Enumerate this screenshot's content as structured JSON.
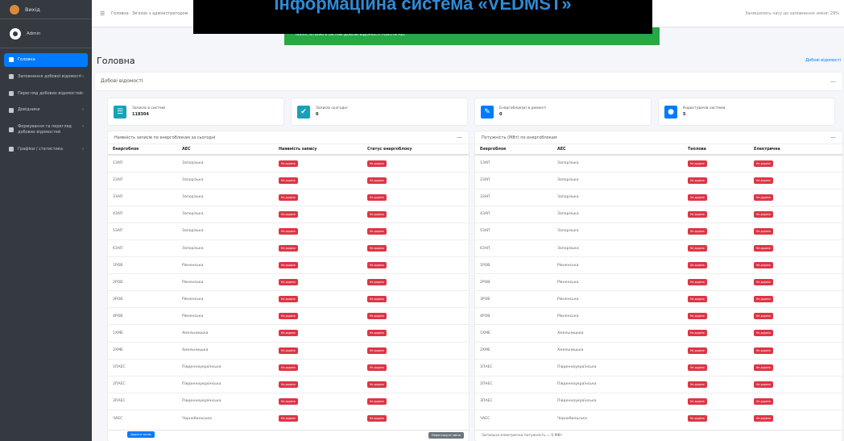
{
  "app": {
    "name": "Вихід"
  },
  "user": {
    "name": "Admin"
  },
  "sidebar": {
    "items": [
      {
        "label": "Головна",
        "active": true
      },
      {
        "label": "Заповнення добової відомості"
      },
      {
        "label": "Перегляд добових відомостей"
      },
      {
        "label": "Довідники"
      },
      {
        "label": "Формування та перегляд добових відомостей"
      },
      {
        "label": "Графіки / статистика"
      }
    ]
  },
  "topbar": {
    "links": [
      "Головна",
      "Зв'язок з адміністратором"
    ],
    "right_text": "Залишилось часу до заповнення зміни: 29%"
  },
  "overlay": {
    "title": "Інформаційна система «VEDMST»"
  },
  "alert": {
    "text": "Admin, вітаємо в системі ДОБОВІ ВІДОМОСТІ РОБОТИ АЕС"
  },
  "page": {
    "title": "Головна",
    "crumb": "Добові відомості"
  },
  "section": {
    "label": "Добові відомості"
  },
  "stats": [
    {
      "title": "Записів в системі",
      "value": "118304",
      "icon": "list-icon",
      "color": "#17a2b8"
    },
    {
      "title": "Записів сьогодні",
      "value": "0",
      "icon": "check-icon",
      "color": "#17a2b8"
    },
    {
      "title": "Енергоблок(и) в ремонті",
      "value": "0",
      "icon": "wrench-icon",
      "color": "#007bff"
    },
    {
      "title": "Користувачів системи",
      "value": "5",
      "icon": "users-icon",
      "color": "#007bff"
    }
  ],
  "left_panel": {
    "title": "Наявність записів по енергоблокам за сьогодні",
    "headers": [
      "Енергоблок",
      "АЕС",
      "Наявність запису",
      "Статус енергоблоку"
    ],
    "badge_text": "Не додано",
    "rows": [
      [
        "1ЗАП",
        "Запорізька"
      ],
      [
        "2ЗАП",
        "Запорізька"
      ],
      [
        "3ЗАП",
        "Запорізька"
      ],
      [
        "4ЗАП",
        "Запорізька"
      ],
      [
        "5ЗАП",
        "Запорізька"
      ],
      [
        "6ЗАП",
        "Запорізька"
      ],
      [
        "1РОВ",
        "Рівненська"
      ],
      [
        "2РОВ",
        "Рівненська"
      ],
      [
        "3РОВ",
        "Рівненська"
      ],
      [
        "4РОВ",
        "Рівненська"
      ],
      [
        "1ХМЕ",
        "Хмельницька"
      ],
      [
        "2ХМЕ",
        "Хмельницька"
      ],
      [
        "1ПАЕС",
        "Південноукраїнська"
      ],
      [
        "2ПАЕС",
        "Південноукраїнська"
      ],
      [
        "3ПАЕС",
        "Південноукраїнська"
      ],
      [
        "ЧАЕС",
        "Чорнобильська"
      ]
    ],
    "add_button": "Додати запис",
    "review_button": "Переглянути зміни"
  },
  "right_panel": {
    "title": "Потужність (МВт) по енергоблокам",
    "headers": [
      "Енергоблок",
      "АЕС",
      "Теплова",
      "Електрична"
    ],
    "badge_text": "Не додано",
    "rows": [
      [
        "1ЗАП",
        "Запорізька"
      ],
      [
        "2ЗАП",
        "Запорізька"
      ],
      [
        "3ЗАП",
        "Запорізька"
      ],
      [
        "4ЗАП",
        "Запорізька"
      ],
      [
        "5ЗАП",
        "Запорізька"
      ],
      [
        "6ЗАП",
        "Запорізька"
      ],
      [
        "1РОВ",
        "Рівненська"
      ],
      [
        "2РОВ",
        "Рівненська"
      ],
      [
        "3РОВ",
        "Рівненська"
      ],
      [
        "4РОВ",
        "Рівненська"
      ],
      [
        "1ХМЕ",
        "Хмельницька"
      ],
      [
        "2ХМЕ",
        "Хмельницька"
      ],
      [
        "1ПАЕС",
        "Південноукраїнська"
      ],
      [
        "2ПАЕС",
        "Південноукраїнська"
      ],
      [
        "3ПАЕС",
        "Південноукраїнська"
      ],
      [
        "ЧАЕС",
        "Чорнобильська"
      ]
    ],
    "total_text": "Загальна електрична потужність = 0 МВт"
  }
}
